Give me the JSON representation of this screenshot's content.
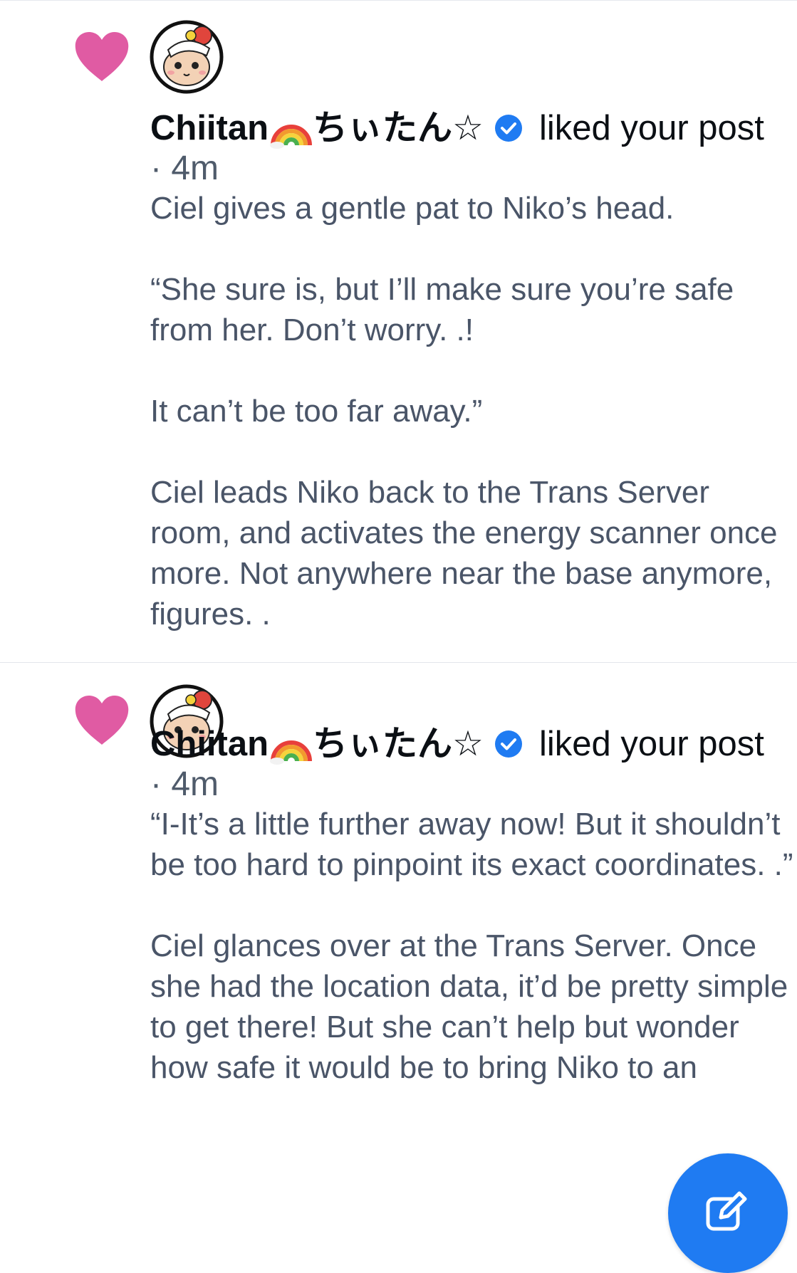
{
  "notifications": [
    {
      "author_name": "Chiitan",
      "name_suffix": "ちぃたん☆",
      "action": "liked your post",
      "timestamp": "· 4m",
      "post_text": "Ciel gives a gentle pat to Niko’s head.\n\n“She sure is, but I’ll make sure you’re safe from her. Don’t worry. .!\n\nIt can’t be too far away.”\n\nCiel leads Niko back to the Trans Server room, and activates the energy scanner once more. Not anywhere near the base anymore, figures. ."
    },
    {
      "author_name": "Chiitan",
      "name_suffix": "ちぃたん☆",
      "action": "liked your post",
      "timestamp": "· 4m",
      "post_text": "“I-It’s a little further away now! But it shouldn’t be too hard to pinpoint its exact coordinates. .”\n\nCiel glances over at the Trans Server. Once she had the location data, it’d be pretty simple to get there! But she can’t help but wonder how safe it would be to bring Niko to an"
    }
  ],
  "icons": {
    "like": "heart-icon",
    "verified": "verified-check-icon",
    "name_emoji": "rainbow-icon",
    "compose": "compose-pencil-icon"
  },
  "colors": {
    "heart": "#e05ba3",
    "verified": "#1f7bf2",
    "compose_button": "#1f7bf2",
    "post_text": "#4a5568"
  }
}
